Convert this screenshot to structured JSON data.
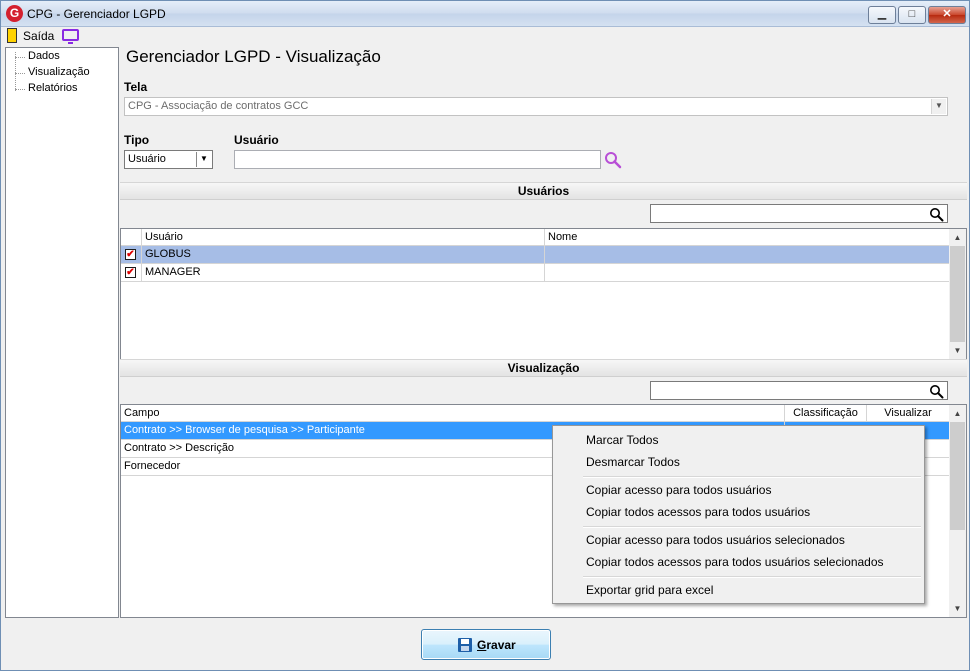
{
  "window": {
    "title": "CPG - Gerenciador LGPD",
    "app_icon_letter": "G",
    "minimize": "▁",
    "maximize": "□",
    "close": "✕"
  },
  "menubar": {
    "exit_label": "Saída"
  },
  "tree": {
    "items": [
      "Dados",
      "Visualização",
      "Relatórios"
    ]
  },
  "main": {
    "title": "Gerenciador LGPD - Visualização",
    "tela_label": "Tela",
    "tela_value": "CPG - Associação de contratos GCC",
    "tipo_label": "Tipo",
    "tipo_value": "Usuário",
    "usuario_label": "Usuário",
    "usuario_value": ""
  },
  "usuarios_section": {
    "header": "Usuários",
    "search_value": "",
    "columns": [
      "Usuário",
      "Nome"
    ],
    "rows": [
      {
        "usuario": "GLOBUS",
        "nome": "",
        "checked": true
      },
      {
        "usuario": "MANAGER",
        "nome": "",
        "checked": true
      }
    ]
  },
  "visualizacao_section": {
    "header": "Visualização",
    "search_value": "",
    "columns": [
      "Campo",
      "Classificação",
      "Visualizar"
    ],
    "rows": [
      {
        "campo": "Contrato >> Browser de pesquisa >> Participante"
      },
      {
        "campo": "Contrato >> Descrição"
      },
      {
        "campo": "Fornecedor"
      }
    ]
  },
  "context_menu": {
    "items": [
      "Marcar Todos",
      "Desmarcar Todos",
      "Copiar acesso para todos usuários",
      "Copiar todos acessos para todos usuários",
      "Copiar acesso para todos usuários selecionados",
      "Copiar todos acessos para todos usuários selecionados",
      "Exportar grid para excel"
    ]
  },
  "footer": {
    "save_first": "G",
    "save_rest": "ravar"
  },
  "icons": {
    "check_mark": "✔",
    "arrow_down": "▼",
    "arrow_up": "▲"
  },
  "colors": {
    "selected_row_blue": "#a6bde6",
    "highlight_row": "#3399ff",
    "search_icon_purple": "#b84fd6"
  }
}
